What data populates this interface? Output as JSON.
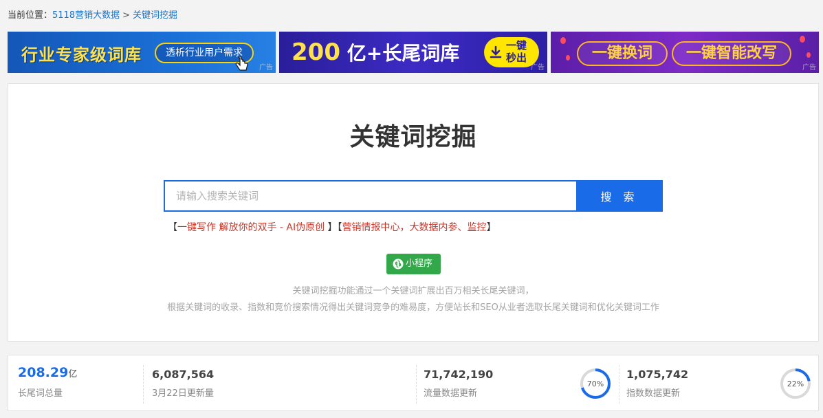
{
  "breadcrumb": {
    "prefix": "当前位置：",
    "home": "5118营销大数据",
    "separator": ">",
    "current": "关键词挖掘"
  },
  "ads": {
    "tag": "广告",
    "ad1": {
      "title": "行业专家级词库",
      "pill": "透析行业用户需求"
    },
    "ad2": {
      "big": "200",
      "title": " 亿+长尾词库",
      "btn_line1": "一键",
      "btn_line2": "秒出"
    },
    "ad3": {
      "pill_a": "一键换词",
      "pill_b": "一键智能改写"
    }
  },
  "main": {
    "title": "关键词挖掘",
    "search_placeholder": "请输入搜索关键词",
    "search_button": "搜 索",
    "promo_open": "【",
    "promo_link1": "一键写作 解放你的双手 - AI伪原创",
    "promo_mid": " 】【",
    "promo_link2": "营销情报中心，大数据内参、监控",
    "promo_close": "】",
    "mini_program": "小程序",
    "desc_line1": "关键词挖掘功能通过一个关键词扩展出百万相关长尾关键词，",
    "desc_line2": "根据关键词的收录、指数和竞价搜索情况得出关键词竞争的难易度，方便站长和SEO从业者选取长尾关键词和优化关键词工作"
  },
  "stats": [
    {
      "value": "208.29",
      "unit": "亿",
      "label": "长尾词总量"
    },
    {
      "value": "6,087,564",
      "label": "3月22日更新量"
    },
    {
      "value": "71,742,190",
      "label": "流量数据更新",
      "percent": 70,
      "percent_label": "70%"
    },
    {
      "value": "1,075,742",
      "label": "指数数据更新",
      "percent": 22,
      "percent_label": "22%"
    }
  ],
  "colors": {
    "accent": "#1a6be8",
    "promo_red": "#c9372a",
    "mini_green": "#32a84a",
    "ring_track": "#d9d9d9"
  }
}
